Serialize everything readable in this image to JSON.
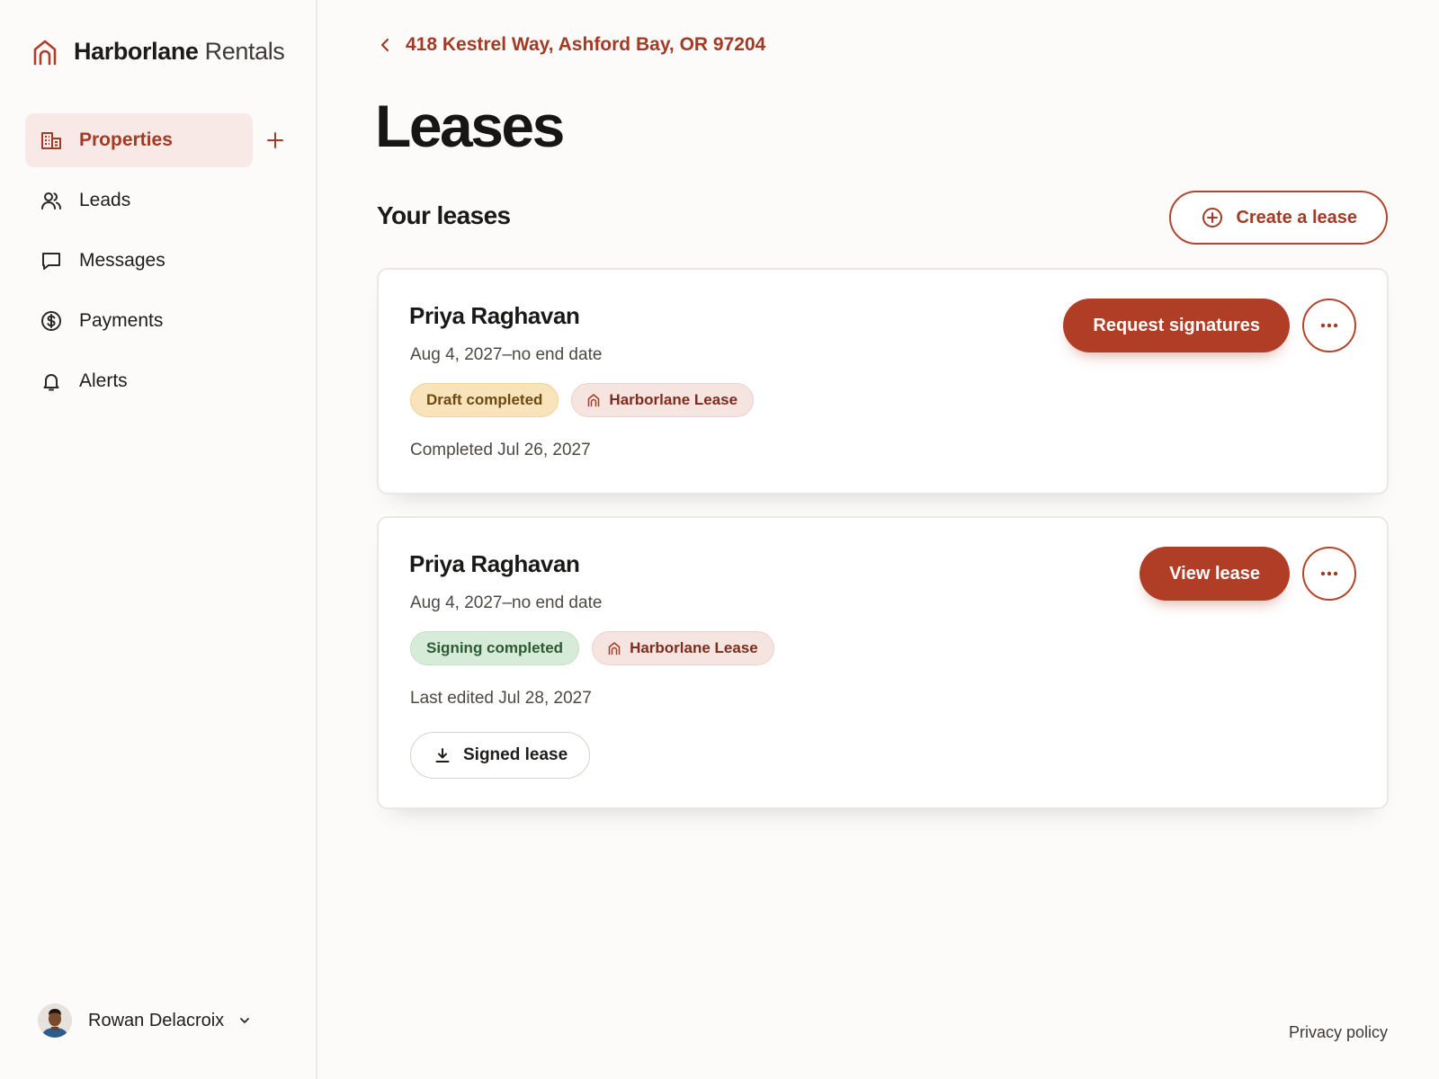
{
  "brand": {
    "name_bold": "Harborlane",
    "name_light": "Rentals",
    "logo_icon": "house-arch-icon"
  },
  "sidebar": {
    "items": [
      {
        "label": "Properties",
        "icon": "building-icon",
        "active": true
      },
      {
        "label": "Leads",
        "icon": "users-icon",
        "active": false
      },
      {
        "label": "Messages",
        "icon": "chat-bubble-icon",
        "active": false
      },
      {
        "label": "Payments",
        "icon": "dollar-circle-icon",
        "active": false
      },
      {
        "label": "Alerts",
        "icon": "bell-icon",
        "active": false
      }
    ],
    "add_icon": "plus-icon"
  },
  "user": {
    "name": "Rowan Delacroix",
    "menu_icon": "chevron-down-icon"
  },
  "breadcrumb": {
    "label": "418 Kestrel Way, Ashford Bay, OR 97204",
    "icon": "chevron-left-icon"
  },
  "page": {
    "title": "Leases",
    "section_title": "Your leases",
    "create_label": "Create a lease"
  },
  "leases": [
    {
      "tenant": "Priya Raghavan",
      "dates": "Aug 4, 2027–no end date",
      "status": "Draft completed",
      "template": "Harborlane Lease",
      "meta": "Completed Jul 26, 2027",
      "primary_action": "Request signatures"
    },
    {
      "tenant": "Priya Raghavan",
      "dates": "Aug 4, 2027–no end date",
      "status": "Signing completed",
      "template": "Harborlane Lease",
      "meta": "Last edited Jul 28, 2027",
      "primary_action": "View lease",
      "download_label": "Signed lease"
    }
  ],
  "footer": {
    "privacy": "Privacy policy"
  },
  "colors": {
    "accent": "#b03e26",
    "accent_text": "#a33a24",
    "active_nav_bg": "#f8e9e6",
    "draft_tag_bg": "#f8e3ba",
    "signed_tag_bg": "#d6ecd8",
    "lease_tag_bg": "#f6e4e0"
  }
}
